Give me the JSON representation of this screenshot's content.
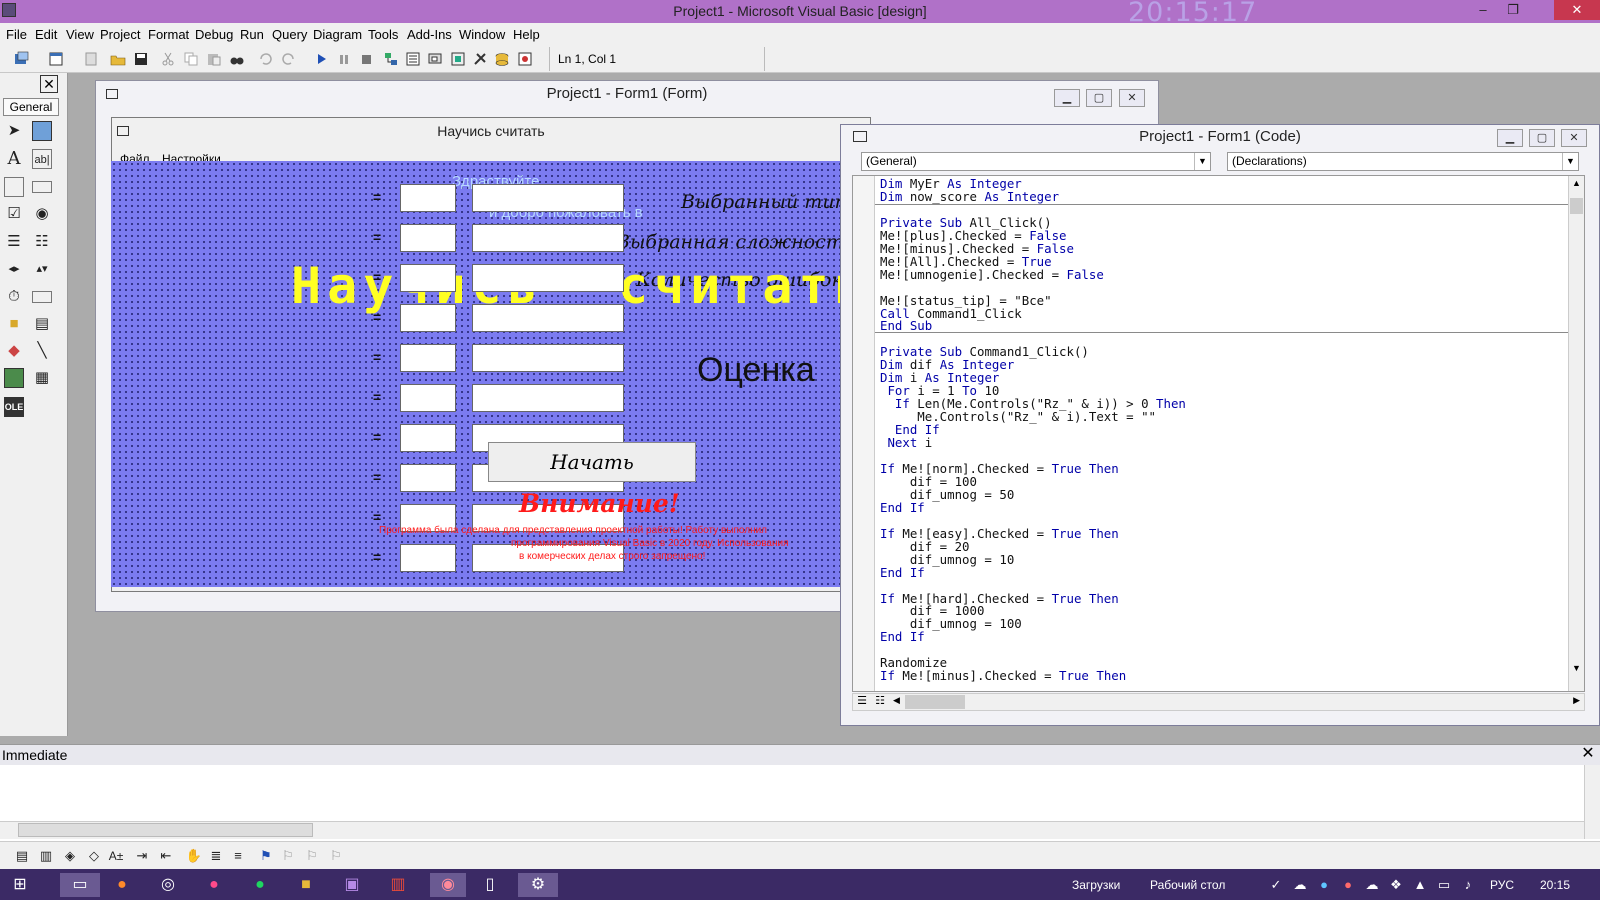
{
  "window": {
    "title": "Project1 - Microsoft Visual Basic [design]",
    "clock": "20:15:17",
    "min": "–",
    "max": "❐",
    "close": "✕"
  },
  "menu": [
    "File",
    "Edit",
    "View",
    "Project",
    "Format",
    "Debug",
    "Run",
    "Query",
    "Diagram",
    "Tools",
    "Add-Ins",
    "Window",
    "Help"
  ],
  "toolbar": {
    "position": "Ln 1, Col 1"
  },
  "toolbox": {
    "close": "✕",
    "tab": "General"
  },
  "form_window": {
    "title": "Project1 - Form1 (Form)",
    "inner_title": "Научись считать",
    "menu": [
      "Файл",
      "Настройки"
    ],
    "eq_sign": "=",
    "greeting1": "Здраствуйте,",
    "greeting2": "и добро пожаловать в",
    "label_type": "Выбранный тип",
    "label_difficulty": "Выбранная сложность",
    "label_errors": "Количество ошибок",
    "big_title_left": "Научись",
    "big_title_right": "считать",
    "grade": "Оценка",
    "start_button": "Начать",
    "attention": "Внимание!",
    "notice": "Программа была сделана для представления проектной работы! Работу выполнил … программирования Visual Basic в 2020 году. Использования … в комерческих делах строго запрещено!",
    "notice_line1": "Программа была сделана для представления проектной работы! Работу выполнил",
    "notice_line2": "программирования Visual Basic в 2020 году. Использования",
    "notice_line3": "в комерческих делах строго запрещено!"
  },
  "code_window": {
    "title": "Project1 - Form1 (Code)",
    "object_combo": "(General)",
    "proc_combo": "(Declarations)"
  },
  "immediate": {
    "title": "Immediate",
    "close": "✕"
  },
  "taskbar": {
    "downloads": "Загрузки",
    "desktop": "Рабочий стол",
    "lang": "РУС",
    "time": "20:15"
  },
  "colors": {
    "title_bar": "#b071c8",
    "form_background": "#7b7bf0",
    "yellow_title": "#ffff22",
    "red_warning": "#ff1a1a",
    "keyword": "#0000a8",
    "taskbar": "#3b2a65"
  }
}
